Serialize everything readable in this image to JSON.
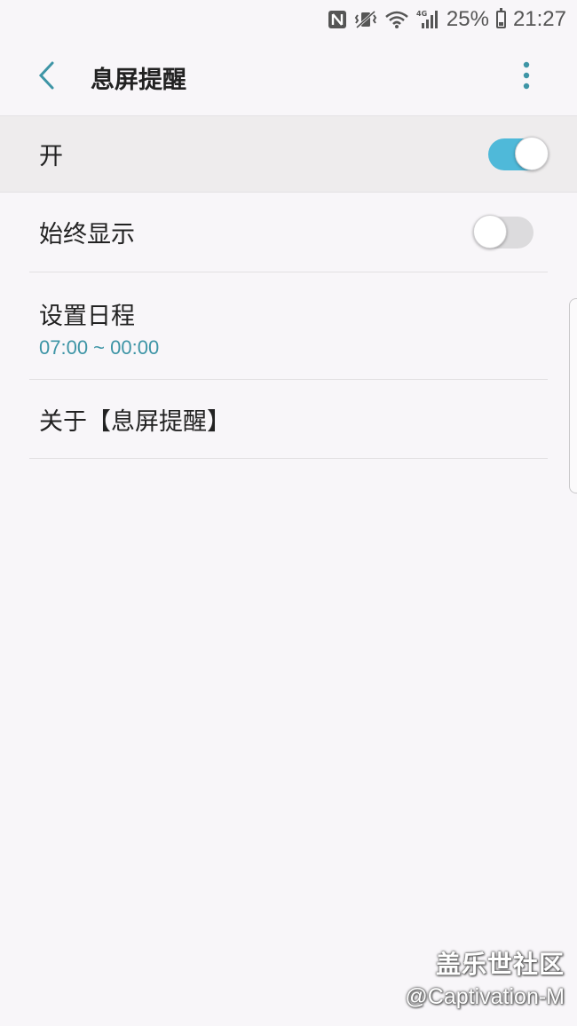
{
  "status_bar": {
    "icons": [
      "nfc-icon",
      "vibrate-icon",
      "wifi-icon",
      "signal-4g-icon"
    ],
    "battery_text": "25%",
    "battery_level": 0.25,
    "time": "21:27"
  },
  "app_bar": {
    "title": "息屏提醒"
  },
  "master_switch": {
    "label": "开",
    "state": "on"
  },
  "settings": [
    {
      "title": "始终显示",
      "toggle": "off"
    },
    {
      "title": "设置日程",
      "subtitle": "07:00 ~ 00:00"
    },
    {
      "title": "关于【息屏提醒】"
    }
  ],
  "watermark": {
    "line1": "盖乐世社区",
    "line2": "@Captivation-M"
  },
  "colors": {
    "accent": "#4fb9d9",
    "subtitle": "#3e95a6",
    "background": "#f8f6f9",
    "master_row_bg": "#eeeced"
  }
}
